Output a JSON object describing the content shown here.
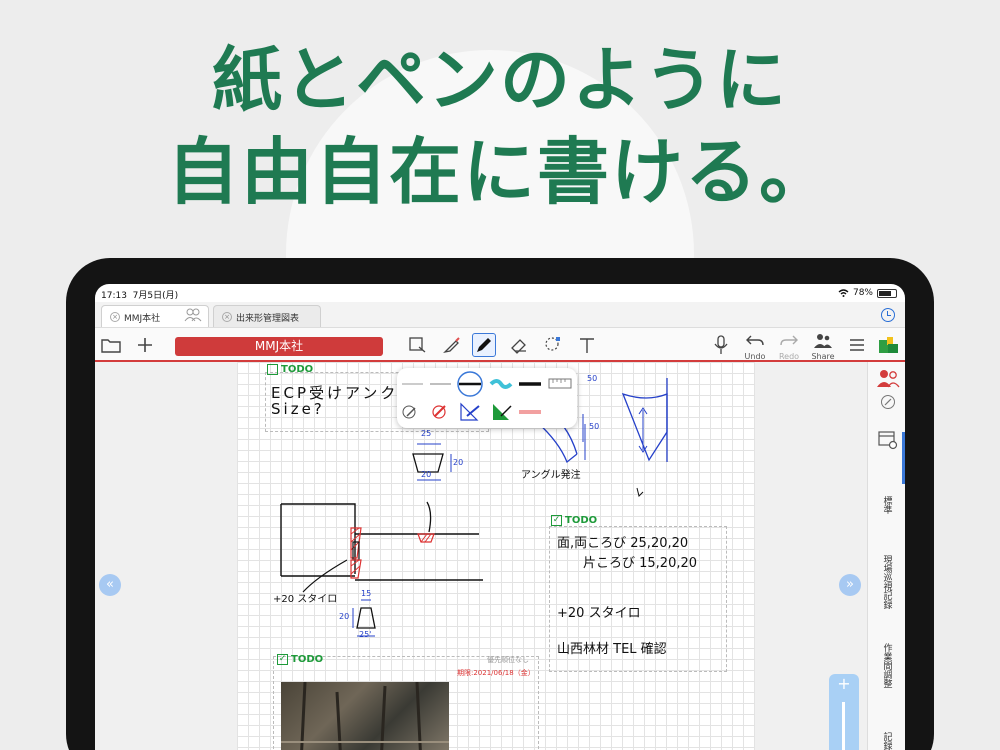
{
  "headline": {
    "line1": "紙とペンのように",
    "line2": "自由自在に書ける。"
  },
  "status_bar": {
    "time": "17:13",
    "date": "7月5日(月)",
    "battery": "78%",
    "battery_level": 0.78
  },
  "tabs": [
    {
      "label": "MMJ本社",
      "active": true
    },
    {
      "label": "出来形管理図表",
      "active": false
    }
  ],
  "toolbar": {
    "document_title": "MMJ本社",
    "undo_label": "Undo",
    "redo_label": "Redo",
    "share_label": "Share"
  },
  "right_panel": {
    "items": [
      "標準",
      "現場巡視記録",
      "作業間調整",
      "記録"
    ]
  },
  "notes": {
    "todo1": {
      "header": "TODO",
      "checked": false,
      "line1": "ECP受けアンク",
      "line2": "Size?"
    },
    "todo2": {
      "header": "TODO",
      "checked": true,
      "line1": "面,両ころび 25,20,20",
      "line2": "片ころび 15,20,20",
      "line3": "+20 スタイロ",
      "line4": "山西林材 TEL 確認"
    },
    "todo3": {
      "header": "TODO",
      "checked": true,
      "priority": "優先順位なし",
      "due": "期限:2021/06/18（金）"
    },
    "sketch_labels": {
      "top_width": "25",
      "top_height": "20",
      "top_bottom": "20",
      "left_note": "+20 スタイロ",
      "bottom_top": "15",
      "bottom_height": "20",
      "bottom_width": "25'",
      "angle_note": "アングル発注",
      "angle_50a": "50",
      "angle_50b": "50"
    }
  },
  "colors": {
    "brand_green": "#1f7a52",
    "title_red": "#cf3b3b",
    "todo_green": "#1e9a3a",
    "accent_blue": "#3a78d8"
  }
}
